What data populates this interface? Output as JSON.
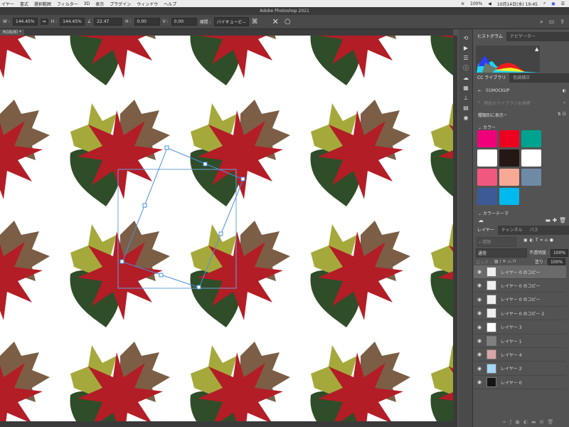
{
  "menubar": {
    "items": [
      "イヤー",
      "書式",
      "選択範囲",
      "フィルター",
      "3D",
      "表示",
      "プラグイン",
      "ウィンドウ",
      "ヘルプ"
    ],
    "battery": "100%",
    "datetime": "10月14日(水) 19:45"
  },
  "window_title": "Adobe Photoshop 2021",
  "options": {
    "w_label": "W :",
    "w": "144.45%",
    "h_label": "H :",
    "h": "144.45%",
    "angle": "22.47",
    "hskew_label": "H :",
    "hskew": "0.00",
    "vskew_label": "V :",
    "vskew": "0.00",
    "interp_label": "補間 :",
    "interp": "バイキュービ−"
  },
  "doc_tab": "RGB/8) *",
  "panels": {
    "histogram_tabs": [
      "ヒストグラム",
      "ナビゲーター"
    ],
    "library_tabs": [
      "CC ライブラリ",
      "色調補正"
    ],
    "library_name": "01MOCKUP",
    "library_search_placeholder": "現在のライブラリを検索",
    "view_by": "種類別に表示",
    "colors_heading": "カラー",
    "swatches": [
      "#f0007a",
      "#ee0020",
      "#00a38f",
      "#ffffff",
      "#231815",
      "#ffffff",
      "#f2577f",
      "#f7a996",
      "#6f8aa5",
      "#3d5a96",
      "#00b9ef"
    ],
    "themes_heading": "カラーテーマ",
    "layer_tabs": [
      "レイヤー",
      "チャンネル",
      "パス"
    ],
    "filter_placeholder": "種類",
    "blend_mode": "通常",
    "opacity_label": "不透明度 :",
    "opacity": "100%",
    "lock_label": "ロック :",
    "fill_label": "塗り :",
    "fill": "100%",
    "layers": [
      {
        "name": "レイヤー 0 のコピー",
        "thumb": "#eeeeee",
        "selected": true
      },
      {
        "name": "レイヤー 0 のコピー",
        "thumb": "#eeeeee"
      },
      {
        "name": "レイヤー 0 のコピー",
        "thumb": "#eeeeee"
      },
      {
        "name": "レイヤー 0 のコピー 2",
        "thumb": "#eeeeee"
      },
      {
        "name": "レイヤー 3",
        "thumb": "#ffffff"
      },
      {
        "name": "レイヤー 1",
        "thumb": "#808080"
      },
      {
        "name": "レイヤー 4",
        "thumb": "#dba3a6"
      },
      {
        "name": "レイヤー 2",
        "thumb": "#a6d6f5"
      },
      {
        "name": "レイヤー 0",
        "thumb": "#151515"
      }
    ]
  }
}
